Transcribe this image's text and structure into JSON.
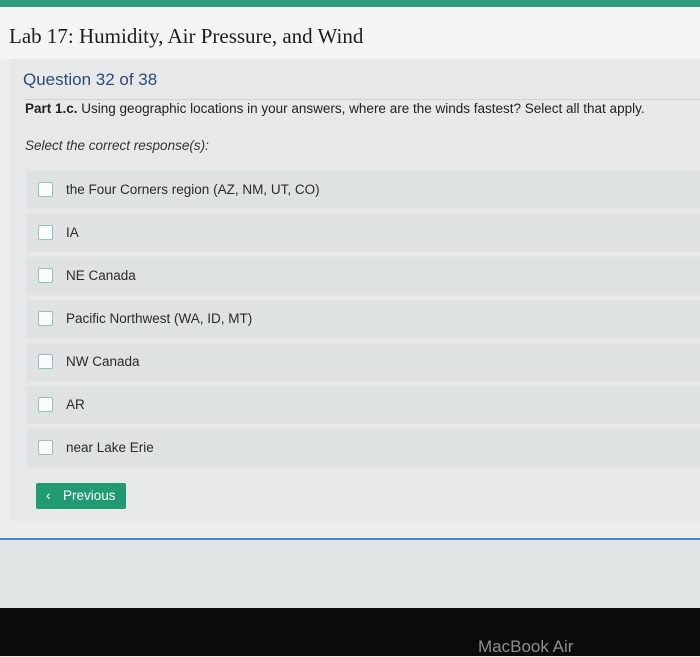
{
  "header": {
    "lab_title": "Lab 17: Humidity, Air Pressure, and Wind"
  },
  "question": {
    "number_label": "Question 32 of 38",
    "part_label": "Part 1.c.",
    "prompt": " Using geographic locations in your answers, where are the winds fastest? Select all that apply.",
    "instruction": "Select the correct response(s):",
    "options": [
      {
        "label": "the Four Corners region (AZ, NM, UT, CO)",
        "checked": false
      },
      {
        "label": "IA",
        "checked": false
      },
      {
        "label": "NE Canada",
        "checked": false
      },
      {
        "label": "Pacific Northwest (WA, ID, MT)",
        "checked": false
      },
      {
        "label": "NW Canada",
        "checked": false
      },
      {
        "label": "AR",
        "checked": false
      },
      {
        "label": "near Lake Erie",
        "checked": false
      }
    ]
  },
  "navigation": {
    "previous_label": "Previous",
    "previous_icon": "chevron-left-icon"
  },
  "device": {
    "bezel_label": "MacBook Air"
  },
  "colors": {
    "accent": "#1f9a72",
    "top_strip": "#2f9b78",
    "question_heading": "#2d4a78",
    "divider_line": "#4a7ed4"
  }
}
